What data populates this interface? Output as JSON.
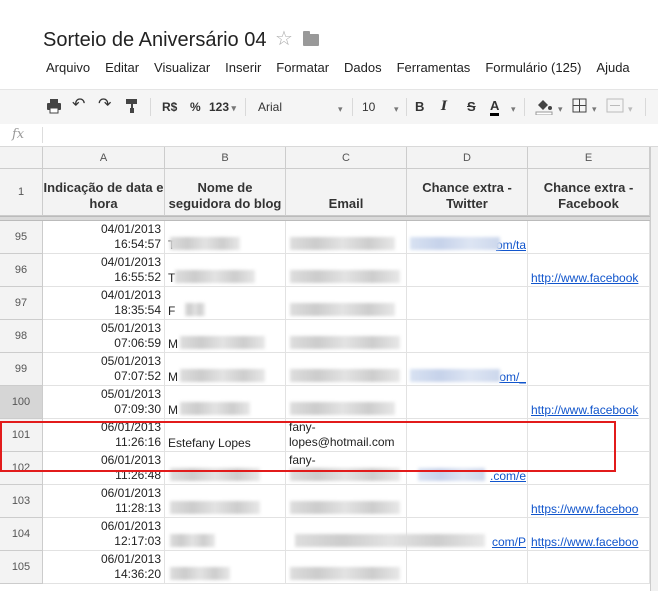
{
  "doc": {
    "title": "Sorteio de Aniversário 04"
  },
  "menu": [
    "Arquivo",
    "Editar",
    "Visualizar",
    "Inserir",
    "Formatar",
    "Dados",
    "Ferramentas",
    "Formulário (125)",
    "Ajuda"
  ],
  "toolbar": {
    "currency": "R$",
    "percent": "%",
    "format": "123",
    "font": "Arial",
    "size": "10",
    "bold": "B",
    "italic": "I",
    "strike": "S",
    "textcolor": "A"
  },
  "fx": {
    "label": "fx"
  },
  "columns": [
    "A",
    "B",
    "C",
    "D",
    "E"
  ],
  "header_row": {
    "num": "1",
    "a": "Indicação de data e hora",
    "b": "Nome de seguidora do blog",
    "c": "Email",
    "d": "Chance extra - Twitter",
    "e": "Chance extra - Facebook"
  },
  "rows": [
    {
      "num": "95",
      "date": "04/01/2013",
      "time": "16:54:57",
      "b_prefix": "T",
      "d_text": "om/ta",
      "e_text": ""
    },
    {
      "num": "96",
      "date": "04/01/2013",
      "time": "16:55:52",
      "b_prefix": "T",
      "d_text": "",
      "e_text": "http://www.facebook"
    },
    {
      "num": "97",
      "date": "04/01/2013",
      "time": "18:35:54",
      "b_prefix": "F",
      "d_text": "",
      "e_text": ""
    },
    {
      "num": "98",
      "date": "05/01/2013",
      "time": "07:06:59",
      "b_prefix": "M",
      "d_text": "",
      "e_text": ""
    },
    {
      "num": "99",
      "date": "05/01/2013",
      "time": "07:07:52",
      "b_prefix": "M",
      "d_text": "om/_",
      "e_text": ""
    },
    {
      "num": "100",
      "date": "05/01/2013",
      "time": "07:09:30",
      "b_prefix": "M",
      "d_text": "",
      "e_text": "http://www.facebook"
    },
    {
      "num": "101",
      "date": "06/01/2013",
      "time": "11:26:16",
      "b_text": "Estefany Lopes",
      "c_line1": "fany-",
      "c_line2": "lopes@hotmail.com"
    },
    {
      "num": "102",
      "date": "06/01/2013",
      "time": "11:26:48",
      "c_line1": "fany-",
      "d_text": ".com/e",
      "e_text": ""
    },
    {
      "num": "103",
      "date": "06/01/2013",
      "time": "11:28:13",
      "d_text": "",
      "e_text": "https://www.faceboo"
    },
    {
      "num": "104",
      "date": "06/01/2013",
      "time": "12:17:03",
      "d_text": "com/P",
      "e_text": "https://www.faceboo"
    },
    {
      "num": "105",
      "date": "06/01/2013",
      "time": "14:36:20",
      "d_text": "",
      "e_text": ""
    }
  ]
}
